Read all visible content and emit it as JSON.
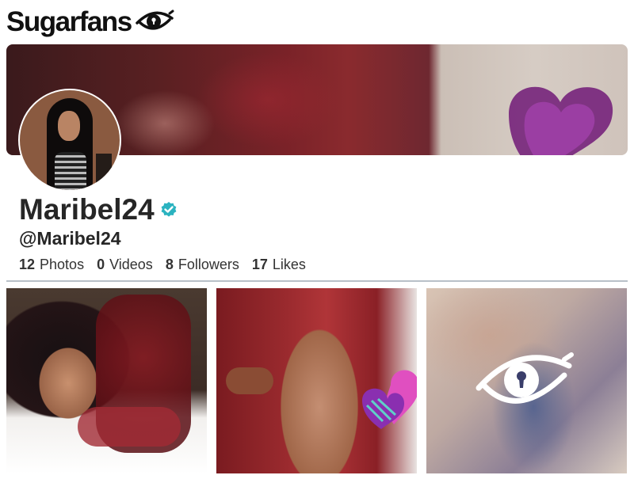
{
  "brand": {
    "name": "Sugarfans",
    "logo_icon": "eye-keyhole-icon"
  },
  "profile": {
    "display_name": "Maribel24",
    "verified": true,
    "verified_icon": "verified-badge-icon",
    "verified_color": "#2bb3c0",
    "handle": "@Maribel24",
    "stats": [
      {
        "count": "12",
        "label": "Photos"
      },
      {
        "count": "0",
        "label": "Videos"
      },
      {
        "count": "8",
        "label": "Followers"
      },
      {
        "count": "17",
        "label": "Likes"
      }
    ]
  },
  "media": [
    {
      "kind": "photo",
      "locked": false
    },
    {
      "kind": "photo",
      "locked": false
    },
    {
      "kind": "photo",
      "locked": true,
      "lock_icon": "eye-keyhole-icon"
    }
  ]
}
